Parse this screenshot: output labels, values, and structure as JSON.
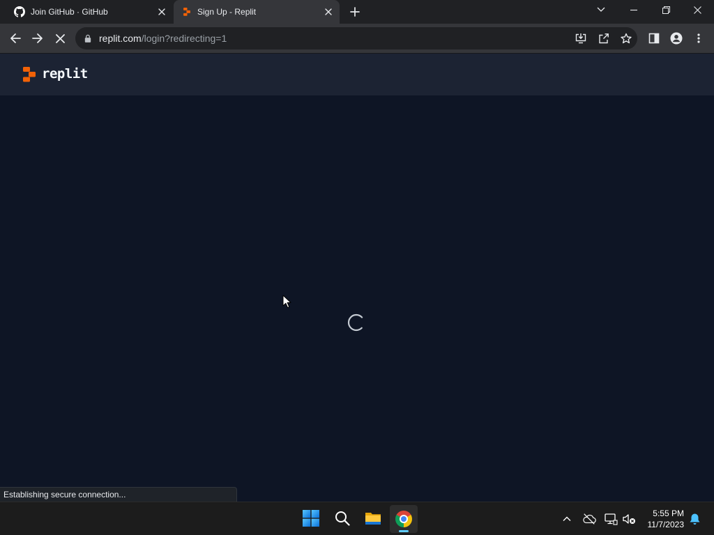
{
  "window": {
    "tabs": [
      {
        "title": "Join GitHub · GitHub",
        "favicon": "github-icon",
        "active": false
      },
      {
        "title": "Sign Up - Replit",
        "favicon": "replit-icon",
        "active": true
      }
    ]
  },
  "toolbar": {
    "address": {
      "host": "replit.com",
      "path": "/login?redirecting=1"
    }
  },
  "page": {
    "header": {
      "logo_text": "replit"
    }
  },
  "status_bubble": {
    "text": "Establishing secure connection..."
  },
  "taskbar": {
    "time": "5:55 PM",
    "date": "11/7/2023",
    "active_app": "chrome-icon"
  },
  "icons": {
    "tab_strip": [
      "github-icon",
      "replit-icon",
      "close-icon",
      "plus-icon",
      "chevron-down-icon",
      "minimize-icon",
      "restore-icon",
      "close-icon"
    ],
    "toolbar": [
      "back-arrow-icon",
      "forward-arrow-icon",
      "stop-loading-icon",
      "lock-icon",
      "install-app-icon",
      "share-icon",
      "star-icon",
      "side-panel-icon",
      "profile-icon",
      "more-vert-icon"
    ],
    "page": [
      "replit-logo-icon",
      "loading-spinner-icon",
      "mouse-cursor-icon"
    ],
    "taskbar": [
      "windows-start-icon",
      "search-icon",
      "file-explorer-icon",
      "chrome-icon",
      "chevron-up-icon",
      "onedrive-paused-icon",
      "network-icon",
      "volume-muted-icon",
      "notification-bell-icon"
    ]
  },
  "colors": {
    "tabstrip_bg": "#202124",
    "toolbar_bg": "#35363a",
    "omnibox_bg": "#202124",
    "header_bg": "#1c2333",
    "page_bg": "#0e1525",
    "brand_orange": "#f26207",
    "taskbar_bg": "#1c1c1c",
    "taskbar_active_bg": "#2d2d2d",
    "active_indicator": "#60cdff"
  }
}
